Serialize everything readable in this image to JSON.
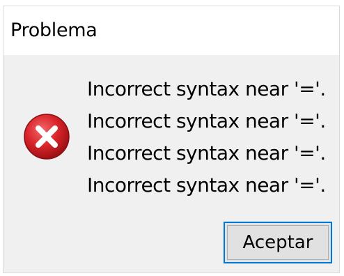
{
  "dialog": {
    "title": "Problema",
    "icon": "error-icon",
    "messages": [
      "Incorrect syntax near '='.",
      "Incorrect syntax near '='.",
      "Incorrect syntax near '='.",
      "Incorrect syntax near '='."
    ],
    "ok_label": "Aceptar"
  },
  "colors": {
    "dialog_bg": "#f0f0f0",
    "title_bg": "#ffffff",
    "error_red": "#d9252b",
    "button_focus": "#0078d7"
  }
}
